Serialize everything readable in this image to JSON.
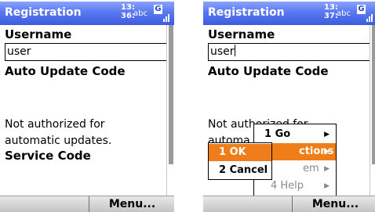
{
  "colors": {
    "titlebar": "#3c5be0",
    "highlight": "#ef7d19",
    "softbar": "#c4c4c4",
    "disabled": "#8a8a8a"
  },
  "left_screen": {
    "title": "Registration",
    "clock_hour": "13:",
    "clock_min": "36:",
    "input_mode": "abc",
    "status_icon": "G",
    "username_label": "Username",
    "username_value": "user",
    "auto_update_label": "Auto Update Code",
    "note_line1": "Not authorized for",
    "note_line2": "automatic updates.",
    "service_code_label": "Service Code",
    "menu_softkey": "Menu..."
  },
  "right_screen": {
    "title": "Registration",
    "clock_hour": "13:",
    "clock_min": "37:",
    "input_mode": "abc",
    "status_icon": "G",
    "username_label": "Username",
    "username_value": "user",
    "auto_update_label": "Auto Update Code",
    "note_line1": "Not authorized for",
    "note_line2": "automa",
    "menu_softkey": "Menu...",
    "main_menu": {
      "items": [
        {
          "label": "1 Go",
          "arrow": "▶"
        },
        {
          "label": "ctions",
          "arrow": "▶"
        },
        {
          "label": "em",
          "arrow": "▶"
        },
        {
          "label": "4 Help",
          "arrow": "▶"
        }
      ]
    },
    "sub_menu": {
      "items": [
        {
          "label": "1 OK"
        },
        {
          "label": "2 Cancel"
        }
      ]
    }
  }
}
